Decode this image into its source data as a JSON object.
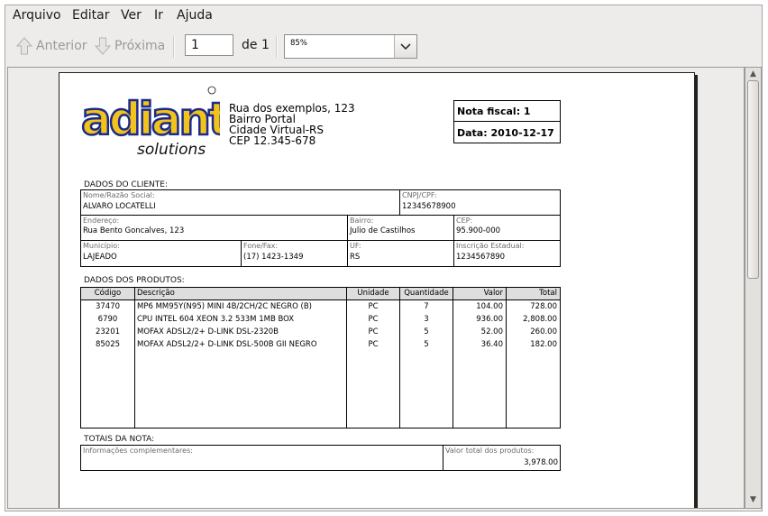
{
  "menu": [
    {
      "label": "Arquivo"
    },
    {
      "label": "Editar"
    },
    {
      "label": "Ver"
    },
    {
      "label": "Ir"
    },
    {
      "label": "Ajuda"
    }
  ],
  "toolbar": {
    "prev_label": "Anterior",
    "next_label": "Próxima",
    "page_value": "1",
    "of_label": "de 1",
    "zoom_value": "85%"
  },
  "doc": {
    "logo_text": "adianti",
    "logo_sub": "solutions",
    "address": [
      "Rua dos exemplos, 123",
      "Bairro Portal",
      "Cidade Virtual-RS",
      "CEP 12.345-678"
    ],
    "nota_fiscal": "Nota fiscal: 1",
    "data": "Data: 2010-12-17",
    "cliente_title": "DADOS DO CLIENTE:",
    "cliente": {
      "nome_label": "Nome/Razão Social:",
      "nome": "ALVARO LOCATELLI",
      "cnpj_label": "CNPJ/CPF:",
      "cnpj": "12345678900",
      "endereco_label": "Endereço:",
      "endereco": "Rua Bento Goncalves, 123",
      "bairro_label": "Bairro:",
      "bairro": "Julio de Castilhos",
      "cep_label": "CEP:",
      "cep": "95.900-000",
      "municipio_label": "Município:",
      "municipio": "LAJEADO",
      "fone_label": "Fone/Fax:",
      "fone": "(17) 1423-1349",
      "uf_label": "UF:",
      "uf": "RS",
      "ie_label": "Inscrição Estadual:",
      "ie": "1234567890"
    },
    "produtos_title": "DADOS DOS PRODUTOS:",
    "columns": [
      "Código",
      "Descrição",
      "Unidade",
      "Quantidade",
      "Valor",
      "Total"
    ],
    "rows": [
      {
        "codigo": "37470",
        "descricao": "MP6 MM95Y(N95) MINI 4B/2CH/2C NEGRO (B)",
        "unidade": "PC",
        "quantidade": "7",
        "valor": "104.00",
        "total": "728.00"
      },
      {
        "codigo": "6790",
        "descricao": "CPU INTEL 604 XEON 3.2  533M 1MB BOX",
        "unidade": "PC",
        "quantidade": "3",
        "valor": "936.00",
        "total": "2,808.00"
      },
      {
        "codigo": "23201",
        "descricao": "MOFAX ADSL2/2+ D-LINK DSL-2320B",
        "unidade": "PC",
        "quantidade": "5",
        "valor": "52.00",
        "total": "260.00"
      },
      {
        "codigo": "85025",
        "descricao": "MOFAX ADSL2/2+ D-LINK DSL-500B GII NEGRO",
        "unidade": "PC",
        "quantidade": "5",
        "valor": "36.40",
        "total": "182.00"
      }
    ],
    "totais_title": "TOTAIS DA NOTA:",
    "info_label": "Informações complementares:",
    "valor_total_label": "Valor total dos produtos:",
    "valor_total": "3,978.00"
  }
}
